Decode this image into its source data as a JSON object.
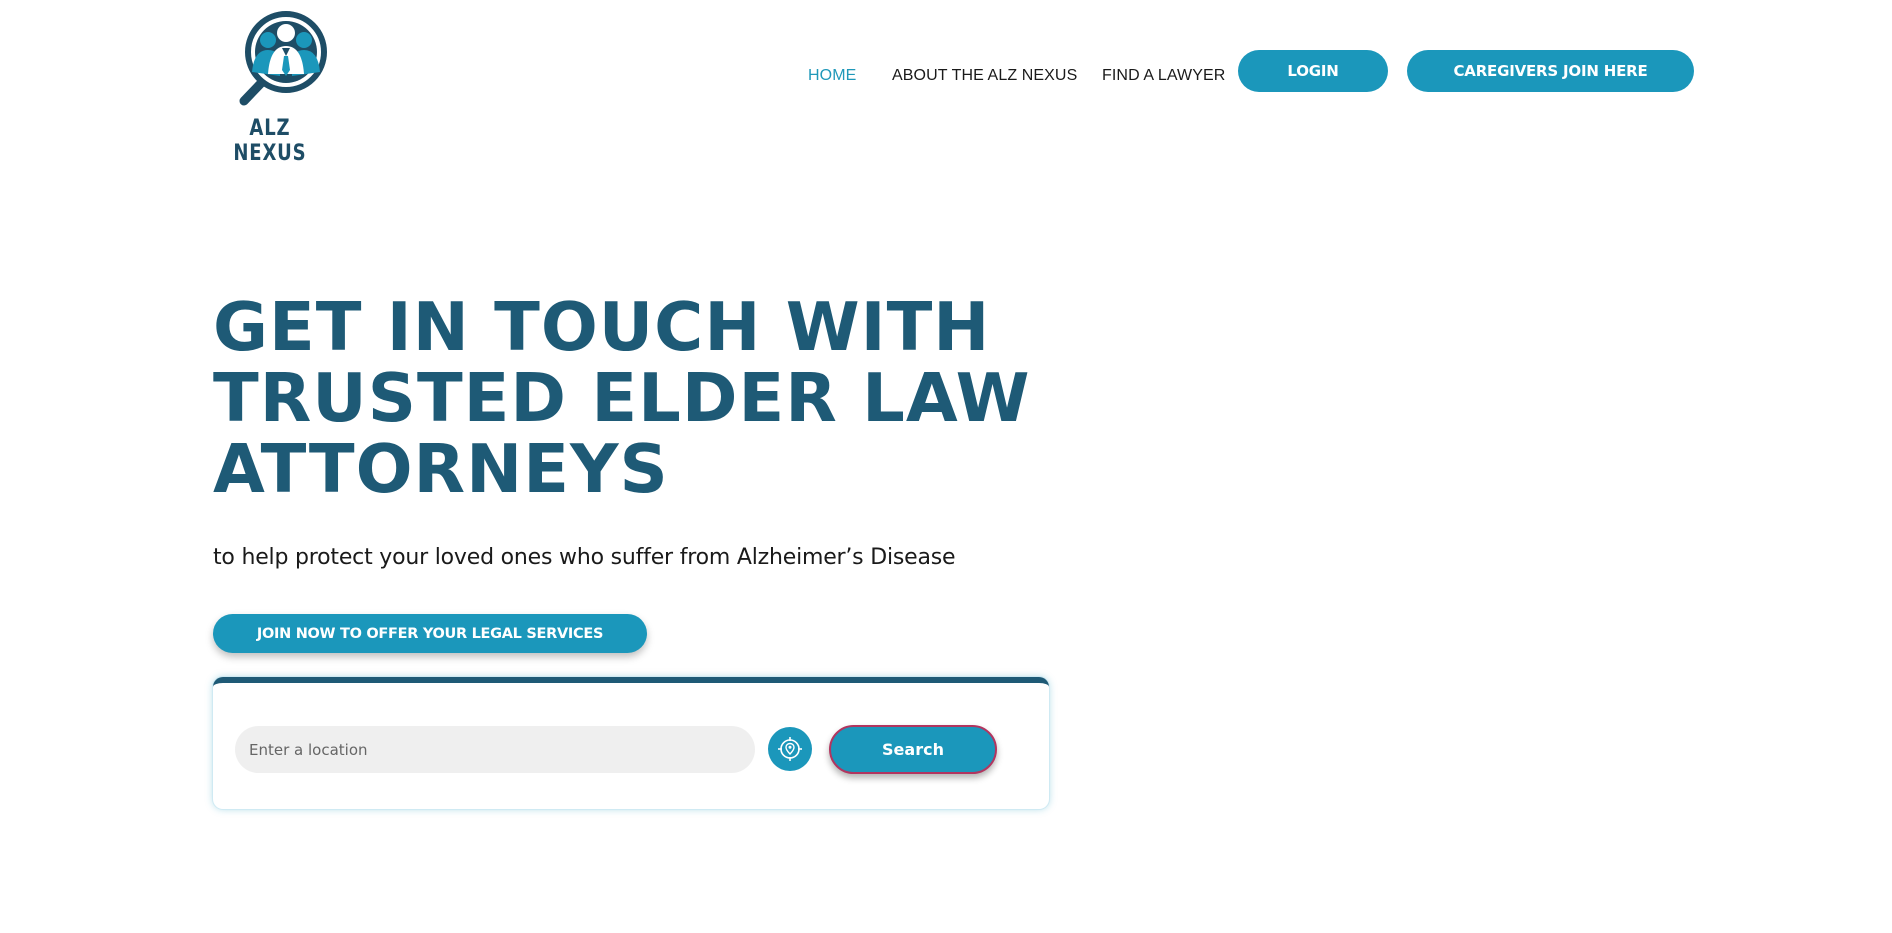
{
  "brand": {
    "name": "ALZ NEXUS",
    "accent": "#1b97bb",
    "dark": "#1e5a76",
    "logo_icon": "magnifier-people-icon"
  },
  "nav": {
    "links": [
      {
        "label": "HOME",
        "active": true
      },
      {
        "label": "ABOUT THE ALZ NEXUS",
        "active": false
      },
      {
        "label": "FIND A LAWYER",
        "active": false
      }
    ],
    "login_label": "LOGIN",
    "caregivers_label": "CAREGIVERS JOIN HERE"
  },
  "hero": {
    "title_lines": [
      "GET IN TOUCH WITH",
      "TRUSTED ELDER LAW",
      "ATTORNEYS"
    ],
    "subtitle": "to help protect your loved ones who suffer from Alzheimer’s Disease",
    "cta_label": "JOIN NOW TO OFFER YOUR LEGAL SERVICES"
  },
  "search": {
    "placeholder": "Enter a location",
    "value": "",
    "locate_icon": "location-target-icon",
    "button_label": "Search"
  }
}
